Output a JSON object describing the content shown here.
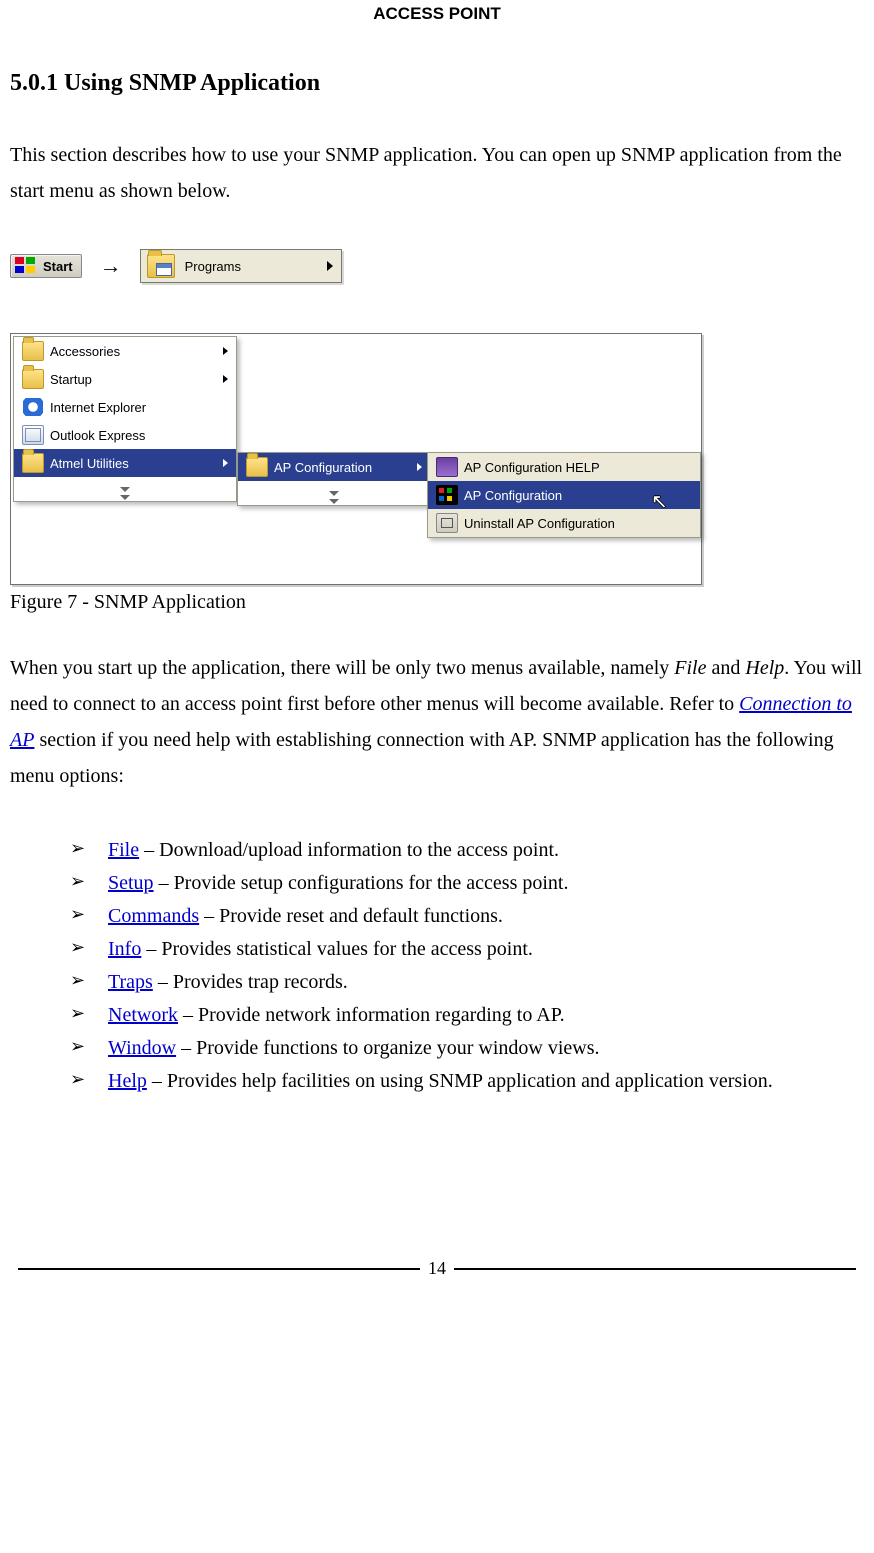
{
  "header": {
    "title": "ACCESS POINT"
  },
  "section": {
    "heading": "5.0.1 Using SNMP Application"
  },
  "intro": {
    "text": "This section describes how to use your SNMP application. You can open up SNMP application from the start menu as shown below."
  },
  "startbar": {
    "start_label": "Start",
    "arrow": "→",
    "programs_label": "Programs"
  },
  "menu": {
    "col1": {
      "items": [
        {
          "label": "Accessories",
          "icon": "folder-icon",
          "submenu": true
        },
        {
          "label": "Startup",
          "icon": "folder-icon",
          "submenu": true
        },
        {
          "label": "Internet Explorer",
          "icon": "ie-icon",
          "submenu": false
        },
        {
          "label": "Outlook Express",
          "icon": "outlook-icon",
          "submenu": false
        },
        {
          "label": "Atmel Utilities",
          "icon": "folder-icon",
          "submenu": true,
          "selected": true
        }
      ]
    },
    "col2": {
      "items": [
        {
          "label": "AP Configuration",
          "icon": "folder-icon",
          "submenu": true,
          "selected": true
        }
      ]
    },
    "col3": {
      "items": [
        {
          "label": "AP Configuration HELP",
          "icon": "help-icon"
        },
        {
          "label": "AP Configuration",
          "icon": "config-icon",
          "selected": true
        },
        {
          "label": "Uninstall AP Configuration",
          "icon": "uninstall-icon"
        }
      ]
    }
  },
  "figure": {
    "caption": "Figure 7 - SNMP Application"
  },
  "para2": {
    "pre": "When you start up the application, there will be only two menus available, namely ",
    "file_i": "File",
    "mid1": " and ",
    "help_i": "Help",
    "mid2": ". You will need to connect to an access point first before other menus will become available. Refer to ",
    "link": "Connection to AP",
    "post": " section if you need help with establishing connection with AP. SNMP application has the following menu options:"
  },
  "bullets": [
    {
      "link": "File",
      "desc": " – Download/upload information to the access point."
    },
    {
      "link": "Setup",
      "desc": " – Provide setup configurations for the access point."
    },
    {
      "link": "Commands",
      "desc": " – Provide reset and default functions."
    },
    {
      "link": "Info",
      "desc": " – Provides statistical values for the access point."
    },
    {
      "link": "Traps",
      "desc": " – Provides trap records."
    },
    {
      "link": "Network",
      "desc": " – Provide network information regarding to AP."
    },
    {
      "link": "Window",
      "desc": " – Provide functions to organize your window views."
    },
    {
      "link": "Help",
      "desc": " – Provides help facilities on using SNMP application and application version."
    }
  ],
  "footer": {
    "page": "14"
  }
}
